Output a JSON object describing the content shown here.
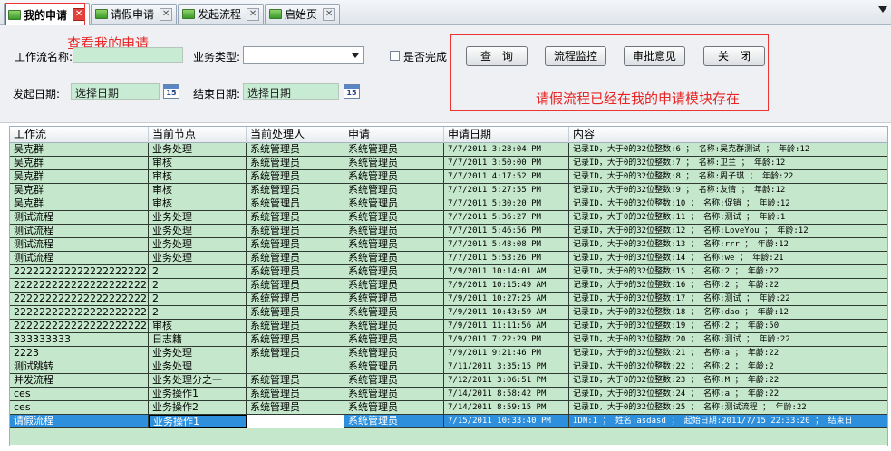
{
  "tabs": [
    {
      "label": "我的申请",
      "active": true
    },
    {
      "label": "请假申请",
      "active": false
    },
    {
      "label": "发起流程",
      "active": false
    },
    {
      "label": "启始页",
      "active": false
    }
  ],
  "tab_close_glyph": "✕",
  "form": {
    "workflow_name_label": "工作流名称:",
    "business_type_label": "业务类型:",
    "completed_label": "是否完成",
    "start_date_label": "发起日期:",
    "end_date_label": "结束日期:",
    "start_date_placeholder": "选择日期",
    "end_date_placeholder": "选择日期",
    "calendar_day": "15"
  },
  "buttons": {
    "query": "查　询",
    "monitor": "流程监控",
    "opinion": "审批意见",
    "close": "关　闭"
  },
  "annotations": {
    "view_my_requests": "查看我的申请",
    "leave_exists": "请假流程已经在我的申请模块存在"
  },
  "grid": {
    "headers": [
      "工作流",
      "当前节点",
      "当前处理人",
      "申请",
      "申请日期",
      "内容"
    ],
    "rows": [
      [
        "吴克群",
        "业务处理",
        "系统管理员",
        "系统管理员",
        "7/7/2011 3:28:04 PM",
        "记录ID，大于0的32位整数:6 ； 名称:吴克群测试 ； 年龄:12"
      ],
      [
        "吴克群",
        "审核",
        "系统管理员",
        "系统管理员",
        "7/7/2011 3:50:00 PM",
        "记录ID，大于0的32位整数:7 ； 名称:卫兰 ； 年龄:12"
      ],
      [
        "吴克群",
        "审核",
        "系统管理员",
        "系统管理员",
        "7/7/2011 4:17:52 PM",
        "记录ID，大于0的32位整数:8 ； 名称:周子琪 ； 年龄:22"
      ],
      [
        "吴克群",
        "审核",
        "系统管理员",
        "系统管理员",
        "7/7/2011 5:27:55 PM",
        "记录ID，大于0的32位整数:9 ； 名称:友情 ； 年龄:12"
      ],
      [
        "吴克群",
        "审核",
        "系统管理员",
        "系统管理员",
        "7/7/2011 5:30:20 PM",
        "记录ID，大于0的32位整数:10 ； 名称:促销 ； 年龄:12"
      ],
      [
        "测试流程",
        "业务处理",
        "系统管理员",
        "系统管理员",
        "7/7/2011 5:36:27 PM",
        "记录ID，大于0的32位整数:11 ； 名称:测试 ； 年龄:1"
      ],
      [
        "测试流程",
        "业务处理",
        "系统管理员",
        "系统管理员",
        "7/7/2011 5:46:56 PM",
        "记录ID，大于0的32位整数:12 ； 名称:LoveYou ； 年龄:12"
      ],
      [
        "测试流程",
        "业务处理",
        "系统管理员",
        "系统管理员",
        "7/7/2011 5:48:08 PM",
        "记录ID，大于0的32位整数:13 ； 名称:rrr ； 年龄:12"
      ],
      [
        "测试流程",
        "业务处理",
        "系统管理员",
        "系统管理员",
        "7/7/2011 5:53:26 PM",
        "记录ID，大于0的32位整数:14 ； 名称:we ； 年龄:21"
      ],
      [
        "2222222222222222222222222",
        "2",
        "系统管理员",
        "系统管理员",
        "7/9/2011 10:14:01 AM",
        "记录ID，大于0的32位整数:15 ； 名称:2 ； 年龄:22"
      ],
      [
        "2222222222222222222222222",
        "2",
        "系统管理员",
        "系统管理员",
        "7/9/2011 10:15:49 AM",
        "记录ID，大于0的32位整数:16 ； 名称:2 ； 年龄:22"
      ],
      [
        "2222222222222222222222222",
        "2",
        "系统管理员",
        "系统管理员",
        "7/9/2011 10:27:25 AM",
        "记录ID，大于0的32位整数:17 ； 名称:测试 ； 年龄:22"
      ],
      [
        "2222222222222222222222222",
        "2",
        "系统管理员",
        "系统管理员",
        "7/9/2011 10:43:59 AM",
        "记录ID，大于0的32位整数:18 ； 名称:dao ； 年龄:12"
      ],
      [
        "2222222222222222222222222",
        "审核",
        "系统管理员",
        "系统管理员",
        "7/9/2011 11:11:56 AM",
        "记录ID，大于0的32位整数:19 ； 名称:2 ； 年龄:50"
      ],
      [
        "333333333",
        "日志籍",
        "系统管理员",
        "系统管理员",
        "7/9/2011 7:22:29 PM",
        "记录ID，大于0的32位整数:20 ； 名称:测试 ； 年龄:22"
      ],
      [
        "2223",
        "业务处理",
        "系统管理员",
        "系统管理员",
        "7/9/2011 9:21:46 PM",
        "记录ID，大于0的32位整数:21 ； 名称:a ； 年龄:22"
      ],
      [
        "测试跳转",
        "业务处理",
        "",
        "系统管理员",
        "7/11/2011 3:35:15 PM",
        "记录ID，大于0的32位整数:22 ； 名称:2 ； 年龄:2"
      ],
      [
        "并发流程",
        "业务处理分之一",
        "系统管理员",
        "系统管理员",
        "7/12/2011 3:06:51 PM",
        "记录ID，大于0的32位整数:23 ； 名称:M ； 年龄:22"
      ],
      [
        "ces",
        "业务操作1",
        "系统管理员",
        "系统管理员",
        "7/14/2011 8:58:42 PM",
        "记录ID，大于0的32位整数:24 ； 名称:a ； 年龄:22"
      ],
      [
        "ces",
        "业务操作2",
        "系统管理员",
        "系统管理员",
        "7/14/2011 8:59:15 PM",
        "记录ID，大于0的32位整数:25 ； 名称:测试流程 ； 年龄:22"
      ],
      [
        "请假流程",
        "业务操作1",
        "",
        "系统管理员",
        "7/15/2011 10:33:40 PM",
        "IDN:1 ； 姓名:asdasd ； 起始日期:2011/7/15 22:33:20 ； 结束日"
      ]
    ],
    "selected_row": 20
  }
}
